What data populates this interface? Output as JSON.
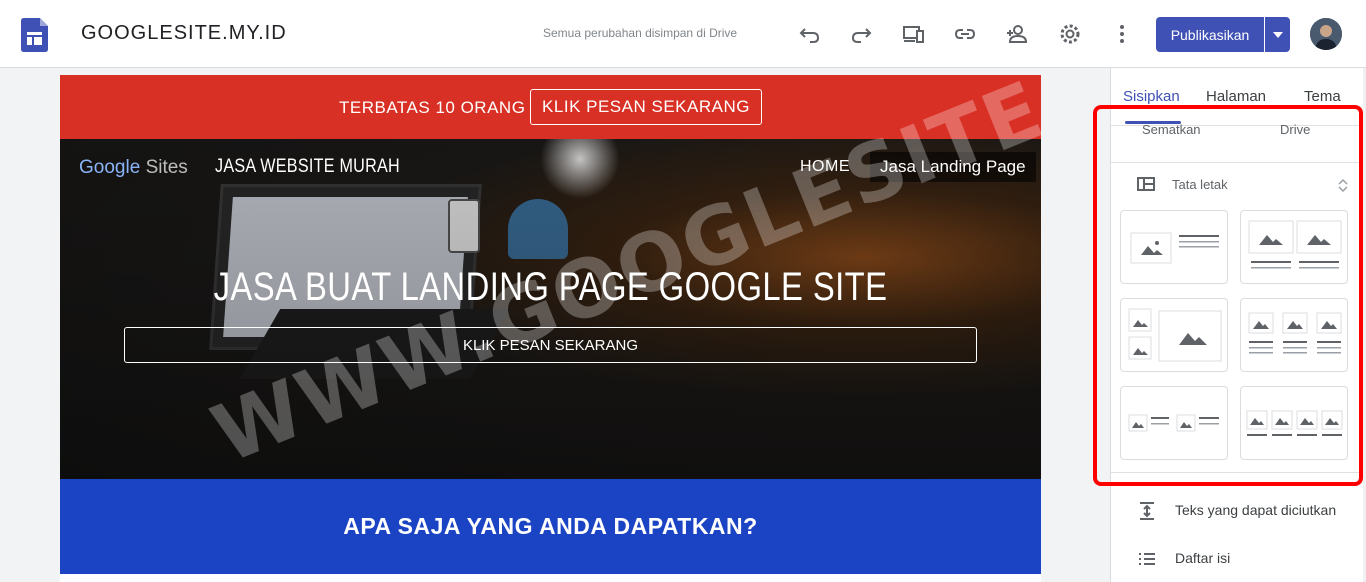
{
  "app": {
    "title": "GOOGLESITE.MY.ID",
    "save_status": "Semua perubahan disimpan di Drive",
    "publish_label": "Publikasikan",
    "accent": "#3f51b5",
    "toolbar_icons": [
      "undo-icon",
      "redo-icon",
      "preview-icon",
      "link-icon",
      "share-icon",
      "settings-icon",
      "more-icon"
    ]
  },
  "canvas": {
    "banner": {
      "text": "TERBATAS 10 ORANG",
      "button": "KLIK PESAN SEKARANG",
      "color": "#d93025"
    },
    "hero": {
      "logo_google": "Google",
      "logo_sites": "Sites",
      "brand": "JASA WEBSITE MURAH",
      "nav_home": "HOME",
      "nav_active": "Jasa Landing Page",
      "title": "JASA BUAT LANDING PAGE GOOGLE SITE",
      "button": "KLIK PESAN SEKARANG"
    },
    "watermark": "WWW.GOOGLESITE.MY.ID",
    "section": {
      "title": "APA SAJA YANG ANDA DAPATKAN?",
      "color": "#1a44c4"
    }
  },
  "panel": {
    "tabs": [
      "Sisipkan",
      "Halaman",
      "Tema"
    ],
    "subtabs": [
      "Sematkan",
      "Drive"
    ],
    "layout_header": "Tata letak",
    "options": [
      "Teks yang dapat diciutkan",
      "Daftar isi"
    ]
  }
}
